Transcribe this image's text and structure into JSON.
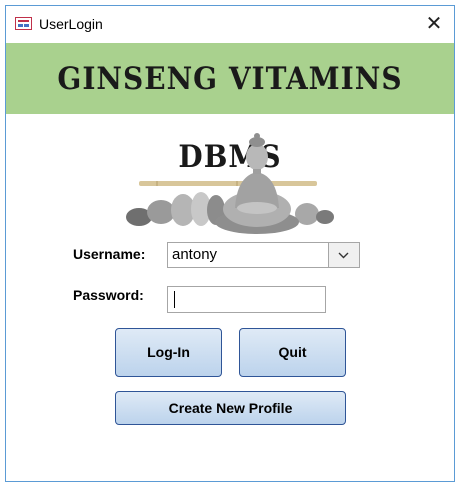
{
  "window": {
    "title": "UserLogin",
    "close_glyph": "✕"
  },
  "banner": {
    "heading": "GINSENG VITAMINS DBMS",
    "background": "#a9d18e"
  },
  "image": {
    "description_icon": "buddha-statue-with-zen-stones"
  },
  "form": {
    "username_label": "Username:",
    "username_value": "antony",
    "password_label": "Password:",
    "password_value": ""
  },
  "buttons": {
    "login": "Log-In",
    "quit": "Quit",
    "create_profile": "Create New Profile"
  },
  "colors": {
    "button_border": "#2f5597",
    "window_border": "#5b9bd5"
  }
}
